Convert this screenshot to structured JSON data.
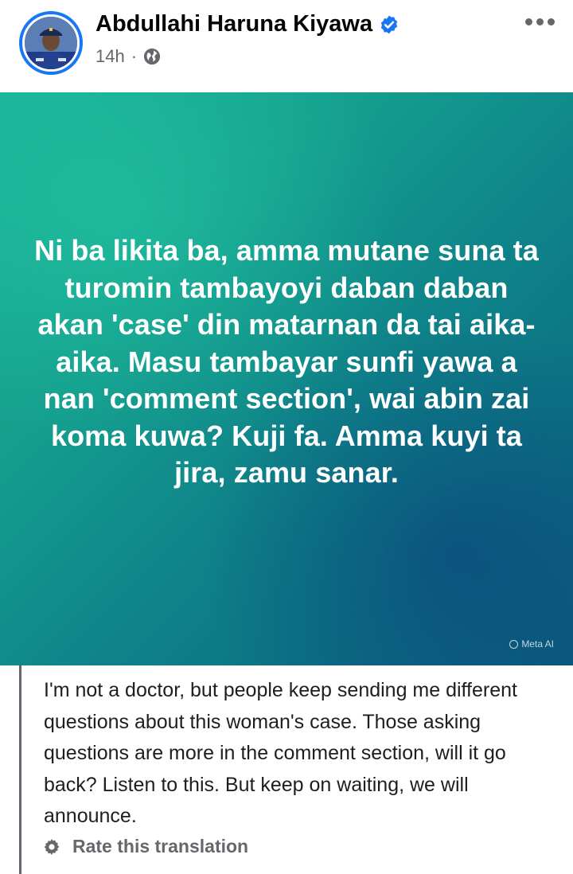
{
  "post": {
    "author": "Abdullahi Haruna Kiyawa",
    "time": "14h",
    "separator": "·",
    "verified_icon": "verified-badge-icon",
    "privacy_icon": "globe-icon",
    "more_icon": "more-options-icon"
  },
  "image": {
    "text": "Ni ba likita ba, amma mutane suna ta turomin tambayoyi daban daban akan 'case' din matarnan da tai aika-aika. Masu tambayar sunfi yawa a nan 'comment section', wai abin zai koma kuwa? Kuji fa. Amma kuyi ta jira, zamu sanar.",
    "watermark": "Meta AI"
  },
  "translation": {
    "text": "I'm not a doctor, but people keep sending me different questions about this woman's case. Those asking questions are more in the comment section, will it go back? Listen to this. But keep on waiting, we will announce.",
    "rate_label": "Rate this translation",
    "rate_icon": "gear-icon"
  },
  "colors": {
    "accent": "#1877f2",
    "gradient_start": "#1ab29a",
    "gradient_end": "#0a5f7e",
    "secondary_text": "#65676b"
  }
}
